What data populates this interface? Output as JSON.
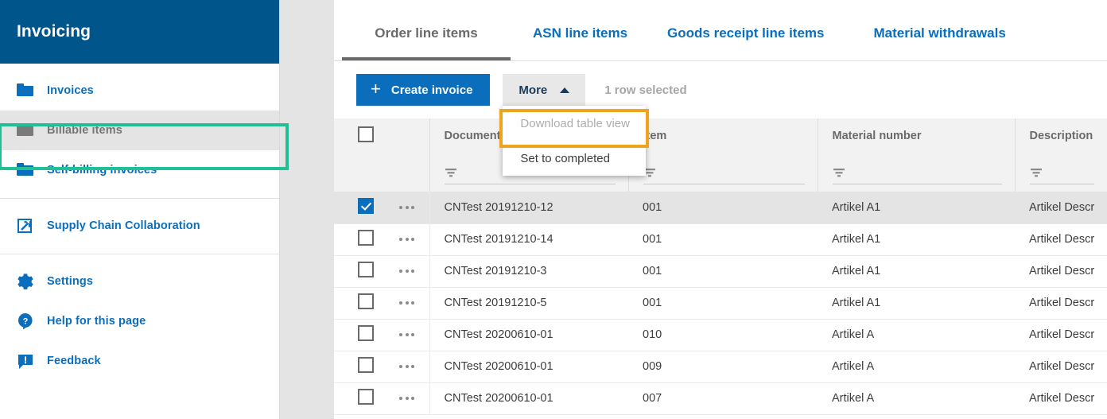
{
  "sidebar": {
    "title": "Invoicing",
    "groups": [
      {
        "items": [
          {
            "label": "Invoices",
            "icon": "folder-icon",
            "active": false
          },
          {
            "label": "Billable items",
            "icon": "folder-icon",
            "active": true
          },
          {
            "label": "Self-billing invoices",
            "icon": "folder-icon",
            "active": false
          }
        ]
      },
      {
        "items": [
          {
            "label": "Supply Chain Collaboration",
            "icon": "external-link-icon",
            "active": false
          }
        ]
      },
      {
        "items": [
          {
            "label": "Settings",
            "icon": "gear-icon",
            "active": false
          },
          {
            "label": "Help for this page",
            "icon": "question-mark-icon",
            "active": false
          },
          {
            "label": "Feedback",
            "icon": "feedback-icon",
            "active": false
          }
        ]
      }
    ]
  },
  "tabs": [
    {
      "label": "Order line items",
      "selected": true
    },
    {
      "label": "ASN line items",
      "selected": false
    },
    {
      "label": "Goods receipt line items",
      "selected": false
    },
    {
      "label": "Material withdrawals",
      "selected": false
    }
  ],
  "toolbar": {
    "create_invoice_label": "Create invoice",
    "more_label": "More",
    "rows_selected_label": "1 row selected",
    "dropdown": {
      "items": [
        {
          "label": "Download table view",
          "disabled": true,
          "highlighted": false
        },
        {
          "label": "Set to completed",
          "disabled": false,
          "highlighted": true
        }
      ]
    }
  },
  "table": {
    "columns": [
      {
        "key": "document_number",
        "label": "Document number"
      },
      {
        "key": "item",
        "label": "Item"
      },
      {
        "key": "material_number",
        "label": "Material number"
      },
      {
        "key": "description",
        "label": "Description"
      }
    ],
    "rows": [
      {
        "selected": true,
        "document_number": "CNTest 20191210-12",
        "item": "001",
        "material_number": "Artikel A1",
        "description": "Artikel Descr"
      },
      {
        "selected": false,
        "document_number": "CNTest 20191210-14",
        "item": "001",
        "material_number": "Artikel A1",
        "description": "Artikel Descr"
      },
      {
        "selected": false,
        "document_number": "CNTest 20191210-3",
        "item": "001",
        "material_number": "Artikel A1",
        "description": "Artikel Descr"
      },
      {
        "selected": false,
        "document_number": "CNTest 20191210-5",
        "item": "001",
        "material_number": "Artikel A1",
        "description": "Artikel Descr"
      },
      {
        "selected": false,
        "document_number": "CNTest 20200610-01",
        "item": "010",
        "material_number": "Artikel A",
        "description": "Artikel Descr"
      },
      {
        "selected": false,
        "document_number": "CNTest 20200610-01",
        "item": "009",
        "material_number": "Artikel A",
        "description": "Artikel Descr"
      },
      {
        "selected": false,
        "document_number": "CNTest 20200610-01",
        "item": "007",
        "material_number": "Artikel A",
        "description": "Artikel Descr"
      }
    ]
  },
  "colors": {
    "brand_header": "#00558b",
    "link_blue": "#0a6ebd",
    "highlight_green": "#21bf96",
    "highlight_orange": "#efa31e",
    "selected_row": "#e4e4e4",
    "muted_text": "#767676"
  }
}
